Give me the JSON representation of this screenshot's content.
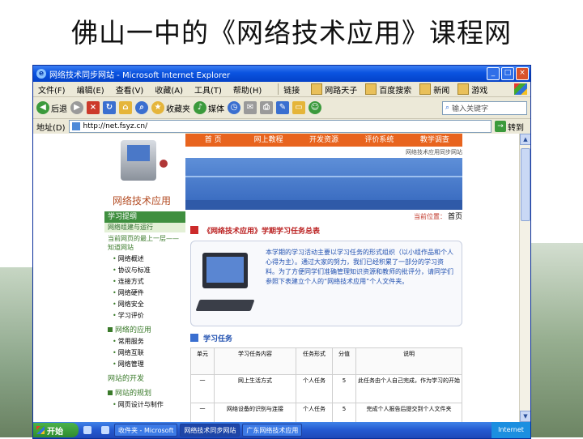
{
  "slide": {
    "title": "佛山一中的《网络技术应用》课程网"
  },
  "window": {
    "title": "网络技术同步网站 - Microsoft Internet Explorer",
    "min": "_",
    "max": "□",
    "close": "×"
  },
  "menu": {
    "items": [
      "文件(F)",
      "编辑(E)",
      "查看(V)",
      "收藏(A)",
      "工具(T)",
      "帮助(H)"
    ],
    "links_label": "链接",
    "links": [
      "网路天子",
      "百度搜索",
      "新闻",
      "游戏"
    ]
  },
  "toolbar": {
    "back": "后退",
    "favorites": "收藏夹",
    "media": "媒体",
    "search_placeholder": "输入关键字"
  },
  "address": {
    "label": "地址(D)",
    "url": "http://net.fsyz.cn/",
    "go": "转到"
  },
  "site": {
    "logo_text": "网络技术应用",
    "nav": [
      "首  页",
      "网上教程",
      "开发资源",
      "评价系统",
      "教学调查"
    ],
    "subinfo": "网络技术应用同步网站",
    "sidebar": {
      "head": "学习提纲",
      "sub": "网络组建与运行",
      "link": "当前网页的最上一层——知道网站",
      "items": [
        "网络概述",
        "协议与标准",
        "连接方式",
        "网络硬件",
        "网络安全",
        "学习评价"
      ],
      "section1": "网络的应用",
      "items2": [
        "常用服务",
        "网络互联",
        "网络管理"
      ],
      "section2_head": "网站的开发",
      "section2": "网站的规划",
      "items3": [
        "网页设计与制作"
      ]
    },
    "crumb": "当前位置：",
    "crumb_home": "首页",
    "sec_title": "《网络技术应用》学期学习任务总表",
    "intro": "本学期的学习活动主要以学习任务的形式组织（以小组作品和个人心得为主）。通过大家的努力，我们已经积累了一部分的学习资料。为了方便同学们准确管理知识资源和教师的批评分，请同学们参照下表建立个人的“网络技术应用”个人文件夹。",
    "tasks_title": "学习任务",
    "table": {
      "headers": [
        "单元",
        "学习任务内容",
        "任务形式",
        "分值",
        "说明"
      ],
      "rows": [
        [
          "一",
          "网上生活方式",
          "个人任务",
          "5",
          "此任务由个人自己完成，作为学习的开始"
        ],
        [
          "一",
          "网络设备的识别与连接",
          "个人任务",
          "5",
          "完成个人报告后提交到个人文件夹"
        ]
      ]
    }
  },
  "taskbar": {
    "start": "开始",
    "tasks": [
      "收件夹 - Microsoft",
      "网络技术同步网站",
      "广东网络技术应用"
    ],
    "tray": "Internet"
  },
  "colors": {
    "accent_nav": "#e8641e",
    "sidebar_green": "#3f8f3f",
    "title_bar": "#0a53e0"
  }
}
